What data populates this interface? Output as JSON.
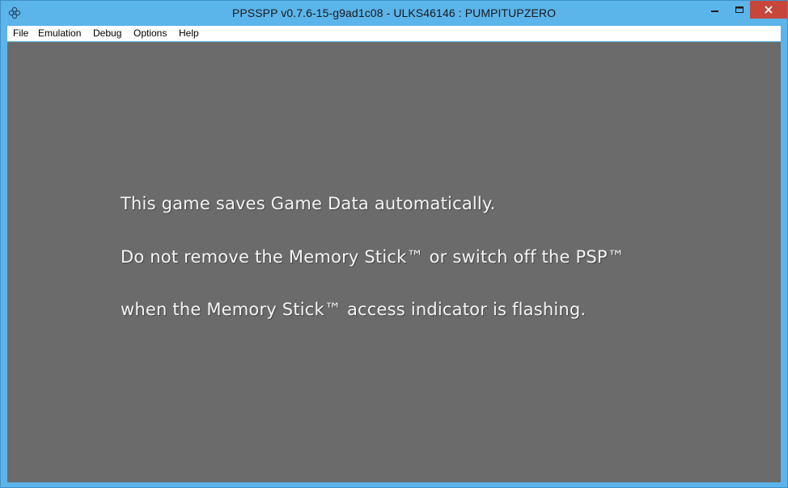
{
  "window": {
    "title": "PPSSPP v0.7.6-15-g9ad1c08 - ULKS46146 : PUMPITUPZERO",
    "icon": "ppsspp-app-icon",
    "controls": {
      "minimize_icon": "minimize-icon",
      "maximize_icon": "maximize-icon",
      "close_icon": "close-icon"
    },
    "accent_color": "#5bb4ea",
    "close_color": "#c7463c"
  },
  "menubar": {
    "items": [
      "File",
      "Emulation",
      "Debug",
      "Options",
      "Help"
    ]
  },
  "game_screen": {
    "background_color": "#6b6b6b",
    "lines": [
      "This game saves Game Data automatically.",
      "Do not remove the Memory Stick™ or switch off the PSP™",
      "when the Memory Stick™ access indicator is flashing."
    ]
  }
}
